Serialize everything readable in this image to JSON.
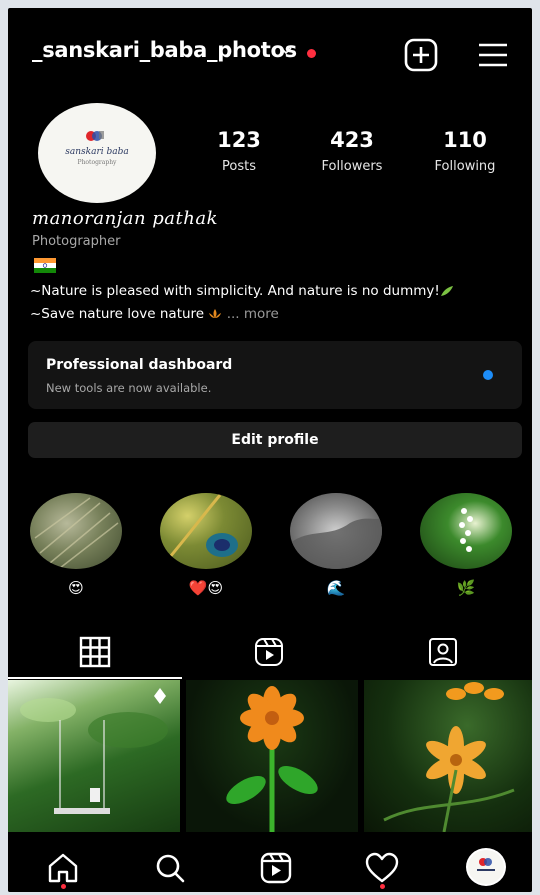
{
  "header": {
    "username": "_sanskari_baba_photos",
    "icons": [
      "chevron-down-icon",
      "notification-dot",
      "create-post-icon",
      "hamburger-menu-icon"
    ]
  },
  "profile": {
    "avatar_logo_text": "sanskari baba",
    "avatar_logo_sub": "Photography",
    "stats": {
      "posts": {
        "value": "123",
        "label": "Posts"
      },
      "followers": {
        "value": "423",
        "label": "Followers"
      },
      "following": {
        "value": "110",
        "label": "Following"
      }
    },
    "full_name": "manoranjan pathak",
    "category": "Photographer",
    "flag": "india-flag",
    "bio_line1": "~Nature is pleased with simplicity. And nature is no dummy!",
    "bio_line2": "~Save nature love nature",
    "bio_more": "... more"
  },
  "dashboard": {
    "title": "Professional dashboard",
    "subtitle": "New tools are now available."
  },
  "edit_profile": {
    "label": "Edit profile"
  },
  "highlights": [
    {
      "label": "😍"
    },
    {
      "label": "❤️😍"
    },
    {
      "label": "🌊"
    },
    {
      "label": "🌿"
    }
  ],
  "tabs": [
    "grid-icon",
    "reels-icon",
    "tagged-icon"
  ],
  "nav": [
    "home-icon",
    "search-icon",
    "reels-icon",
    "heart-icon",
    "profile-avatar"
  ],
  "colors": {
    "background": "#000000",
    "accent_blue": "#1d8df8",
    "notification_red": "#ff2f40",
    "card": "#141414",
    "button": "#1e1e1e"
  }
}
